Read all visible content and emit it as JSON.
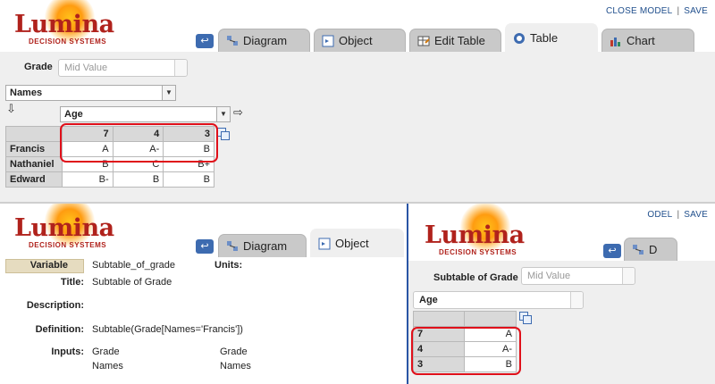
{
  "brand": {
    "name": "Lumina",
    "tagline": "DECISION SYSTEMS"
  },
  "top_links": {
    "close": "CLOSE MODEL",
    "save": "SAVE",
    "sep": "|",
    "close_partial": "ODEL"
  },
  "tabs": {
    "diagram": "Diagram",
    "object": "Object",
    "edit_table": "Edit Table",
    "table": "Table",
    "chart": "Chart",
    "partial_diagram": "D"
  },
  "table_view": {
    "var_label": "Grade",
    "var_field": "Mid Value",
    "row_index": "Names",
    "col_index": "Age",
    "col_headers": [
      "7",
      "4",
      "3"
    ],
    "rows": [
      {
        "name": "Francis",
        "values": [
          "A",
          "A-",
          "B"
        ]
      },
      {
        "name": "Nathaniel",
        "values": [
          "B",
          "C",
          "B+"
        ]
      },
      {
        "name": "Edward",
        "values": [
          "B-",
          "B",
          "B"
        ]
      }
    ]
  },
  "object_view": {
    "class": "Variable",
    "identifier": "Subtable_of_grade",
    "units_label": "Units:",
    "title_label": "Title:",
    "title": "Subtable of Grade",
    "description_label": "Description:",
    "definition_label": "Definition:",
    "definition": "Subtable(Grade[Names='Francis'])",
    "inputs_label": "Inputs:",
    "inputs": [
      "Grade",
      "Names"
    ],
    "inputs_right": [
      "Grade",
      "Names"
    ]
  },
  "subtable_view": {
    "var_label": "Subtable of Grade",
    "var_field": "Mid Value",
    "index": "Age",
    "rows": [
      {
        "name": "7",
        "value": "A"
      },
      {
        "name": "4",
        "value": "A-"
      },
      {
        "name": "3",
        "value": "B"
      }
    ]
  },
  "colors": {
    "brand_red": "#b0221c",
    "link_blue": "#1f4e8c",
    "highlight_red": "#e0101a",
    "tab_gray": "#c9c9c9",
    "body_gray": "#efefef"
  }
}
